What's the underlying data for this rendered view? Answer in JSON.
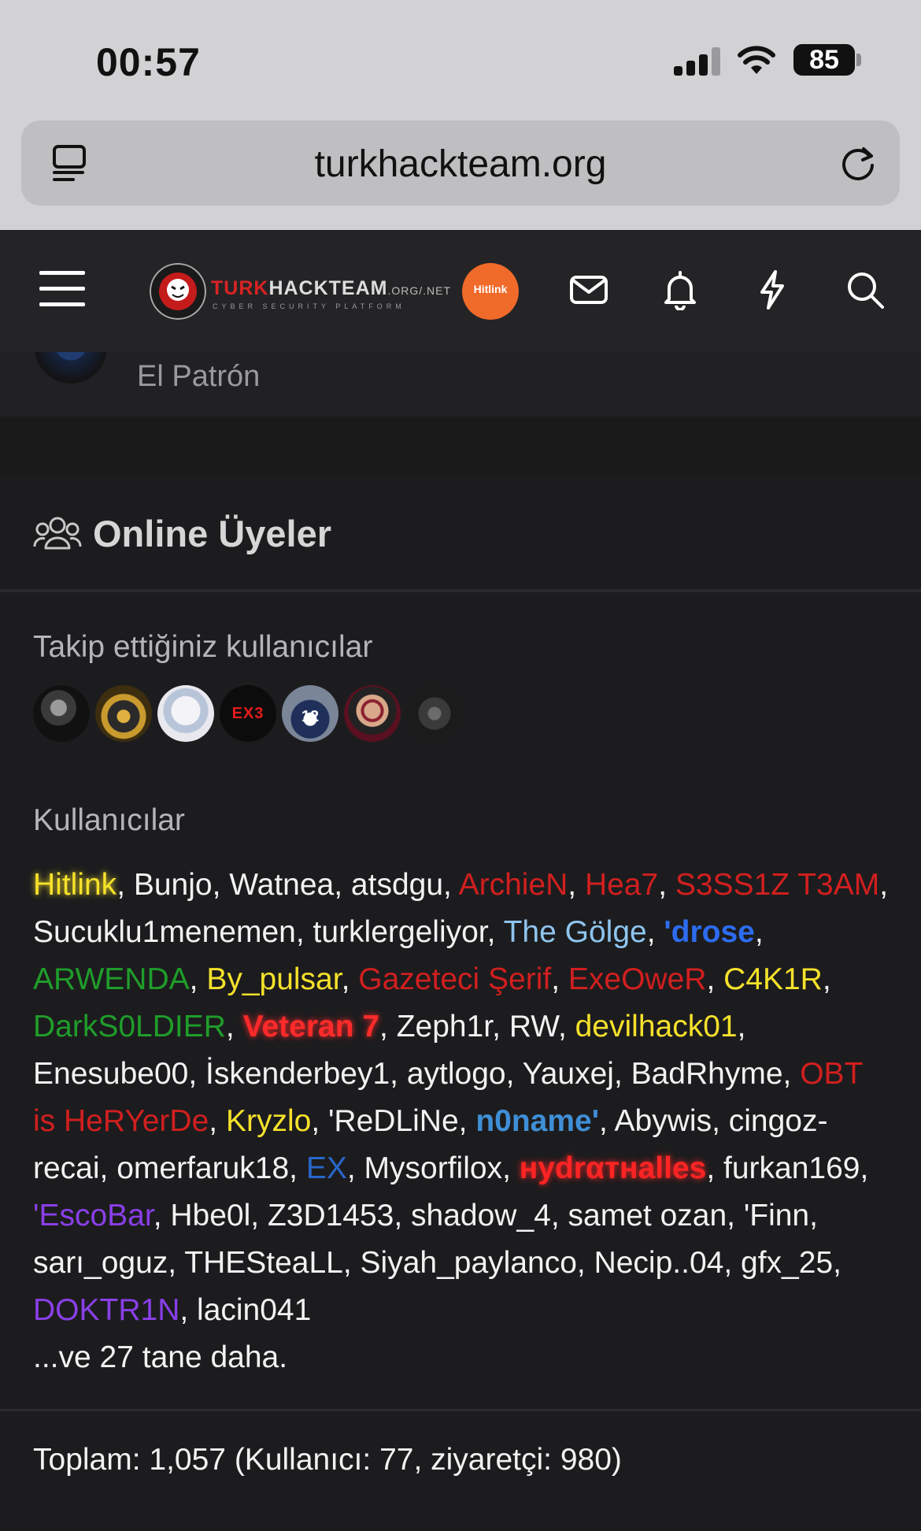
{
  "status_bar": {
    "time": "00:57",
    "battery": "85"
  },
  "browser": {
    "url": "turkhackteam.org"
  },
  "header": {
    "logo_turk": "TURK",
    "logo_hack": "HACK",
    "logo_team": "TEAM",
    "logo_suffix": ".ORG/.NET",
    "logo_subtitle": "CYBER SECURITY PLATFORM",
    "logo_ring": "TURKHACKTEAM",
    "badge_label": "Hitlink",
    "badge_icons": "🔗 🚀 G"
  },
  "partial": {
    "name": "El Patrón"
  },
  "online": {
    "title": "Online Üyeler",
    "followed_label": "Takip ettiğiniz kullanıcılar",
    "followed_avatars": [
      "avatar-1",
      "avatar-2",
      "avatar-3",
      "avatar-ex3",
      "avatar-12",
      "avatar-6",
      "avatar-wolf"
    ],
    "ex3_text": "EX3",
    "twelve_text": "12",
    "users_label": "Kullanıcılar",
    "users": [
      {
        "name": "Hitlink",
        "color": "#f5e12b",
        "bold": false,
        "glow": true
      },
      {
        "name": "Bunjo",
        "color": "#f2f2f2"
      },
      {
        "name": "Watnea",
        "color": "#f2f2f2"
      },
      {
        "name": "atsdgu",
        "color": "#f2f2f2"
      },
      {
        "name": "ArchieN",
        "color": "#d11f1f"
      },
      {
        "name": "Hea7",
        "color": "#d11f1f"
      },
      {
        "name": "S3SS1Z T3AM",
        "color": "#d11f1f"
      },
      {
        "name": "Sucuklu1menemen",
        "color": "#f2f2f2"
      },
      {
        "name": "turklergeliyor",
        "color": "#f2f2f2"
      },
      {
        "name": "The Gölge",
        "color": "#8ec5ee"
      },
      {
        "name": "'drose",
        "color": "#2d6cf0",
        "bold": true
      },
      {
        "name": "ARWENDA",
        "color": "#1f9d2a"
      },
      {
        "name": "By_pulsar",
        "color": "#f5e12b"
      },
      {
        "name": "Gazeteci Şerif",
        "color": "#d11f1f"
      },
      {
        "name": "ExeOweR",
        "color": "#d11f1f"
      },
      {
        "name": "C4K1R",
        "color": "#f5e12b"
      },
      {
        "name": "DarkS0LDIER",
        "color": "#1f9d2a"
      },
      {
        "name": "Veteran 7",
        "color": "#ff2a2a",
        "bold": true,
        "glow": true
      },
      {
        "name": "Zeph1r",
        "color": "#f2f2f2"
      },
      {
        "name": "RW",
        "color": "#f2f2f2"
      },
      {
        "name": "devilhack01",
        "color": "#f5e12b"
      },
      {
        "name": "Enesube00",
        "color": "#f2f2f2"
      },
      {
        "name": "İskenderbey1",
        "color": "#f2f2f2"
      },
      {
        "name": "aytlogo",
        "color": "#f2f2f2"
      },
      {
        "name": "Yauxej",
        "color": "#f2f2f2"
      },
      {
        "name": "BadRhyme",
        "color": "#f2f2f2"
      },
      {
        "name": "OBT is HeRYerDe",
        "color": "#d11f1f"
      },
      {
        "name": "Kryzlo",
        "color": "#f5e12b"
      },
      {
        "name": "'ReDLiNe",
        "color": "#f2f2f2"
      },
      {
        "name": "n0name'",
        "color": "#3f8fd6",
        "bold": true
      },
      {
        "name": "Abywis",
        "color": "#f2f2f2"
      },
      {
        "name": "cingoz-recai",
        "color": "#f2f2f2"
      },
      {
        "name": "omerfaruk18",
        "color": "#f2f2f2"
      },
      {
        "name": "EX",
        "color": "#2966c9"
      },
      {
        "name": "Mysorfilox",
        "color": "#f2f2f2"
      },
      {
        "name": "нydrαтнalles",
        "color": "#ff2424",
        "bold": true,
        "glow": true
      },
      {
        "name": "furkan169",
        "color": "#f2f2f2"
      },
      {
        "name": "'EscoBar",
        "color": "#8a3fe8"
      },
      {
        "name": "Hbe0l",
        "color": "#f2f2f2"
      },
      {
        "name": "Z3D1453",
        "color": "#f2f2f2"
      },
      {
        "name": "shadow_4",
        "color": "#f2f2f2"
      },
      {
        "name": "samet ozan",
        "color": "#f2f2f2"
      },
      {
        "name": "'Finn",
        "color": "#f2f2f2"
      },
      {
        "name": "sarı_oguz",
        "color": "#f2f2f2"
      },
      {
        "name": "THESteaLL",
        "color": "#f2f2f2"
      },
      {
        "name": "Siyah_paylanco",
        "color": "#f2f2f2"
      },
      {
        "name": "Necip..04",
        "color": "#f2f2f2"
      },
      {
        "name": "gfx_25",
        "color": "#f2f2f2"
      },
      {
        "name": "DOKTR1N",
        "color": "#8a3fe8"
      },
      {
        "name": "lacin041",
        "color": "#f2f2f2"
      }
    ],
    "more_text": "...ve 27 tane daha.",
    "total_text": "Toplam: 1,057 (Kullanıcı: 77, ziyaretçi: 980)"
  }
}
